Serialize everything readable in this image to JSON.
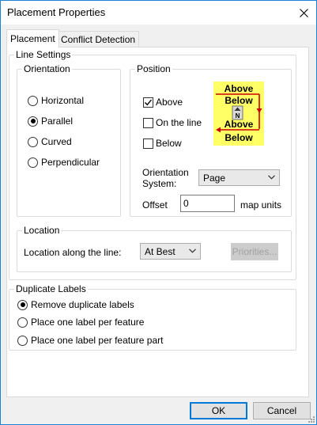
{
  "window": {
    "title": "Placement Properties"
  },
  "tabs": [
    {
      "label": "Placement",
      "active": true
    },
    {
      "label": "Conflict Detection",
      "active": false
    }
  ],
  "line_settings": {
    "title": "Line Settings",
    "orientation": {
      "title": "Orientation",
      "options": [
        {
          "label": "Horizontal",
          "checked": false
        },
        {
          "label": "Parallel",
          "checked": true
        },
        {
          "label": "Curved",
          "checked": false
        },
        {
          "label": "Perpendicular",
          "checked": false
        }
      ]
    },
    "position": {
      "title": "Position",
      "options": [
        {
          "label": "Above",
          "checked": true
        },
        {
          "label": "On the line",
          "checked": false
        },
        {
          "label": "Below",
          "checked": false
        }
      ],
      "preview": {
        "top_above": "Above",
        "top_below": "Below",
        "bottom_above": "Above",
        "bottom_below": "Below",
        "north": "N",
        "text_color": "#000000",
        "line_color": "#cc0000",
        "background": "#ffff66"
      },
      "orientation_system_label": "Orientation\nSystem:",
      "orientation_system_value": "Page",
      "offset_label": "Offset",
      "offset_value": "0",
      "offset_units": "map units"
    }
  },
  "location": {
    "title": "Location",
    "along_line_label": "Location along the line:",
    "along_line_value": "At Best",
    "priorities_label": "Priorities..."
  },
  "duplicate_labels": {
    "title": "Duplicate Labels",
    "options": [
      {
        "label": "Remove duplicate labels",
        "checked": true
      },
      {
        "label": "Place one label per feature",
        "checked": false
      },
      {
        "label": "Place one label per feature part",
        "checked": false
      }
    ]
  },
  "footer": {
    "ok_label": "OK",
    "cancel_label": "Cancel"
  },
  "colors": {
    "accent": "#0078d7",
    "window_border": "#1883d7"
  }
}
